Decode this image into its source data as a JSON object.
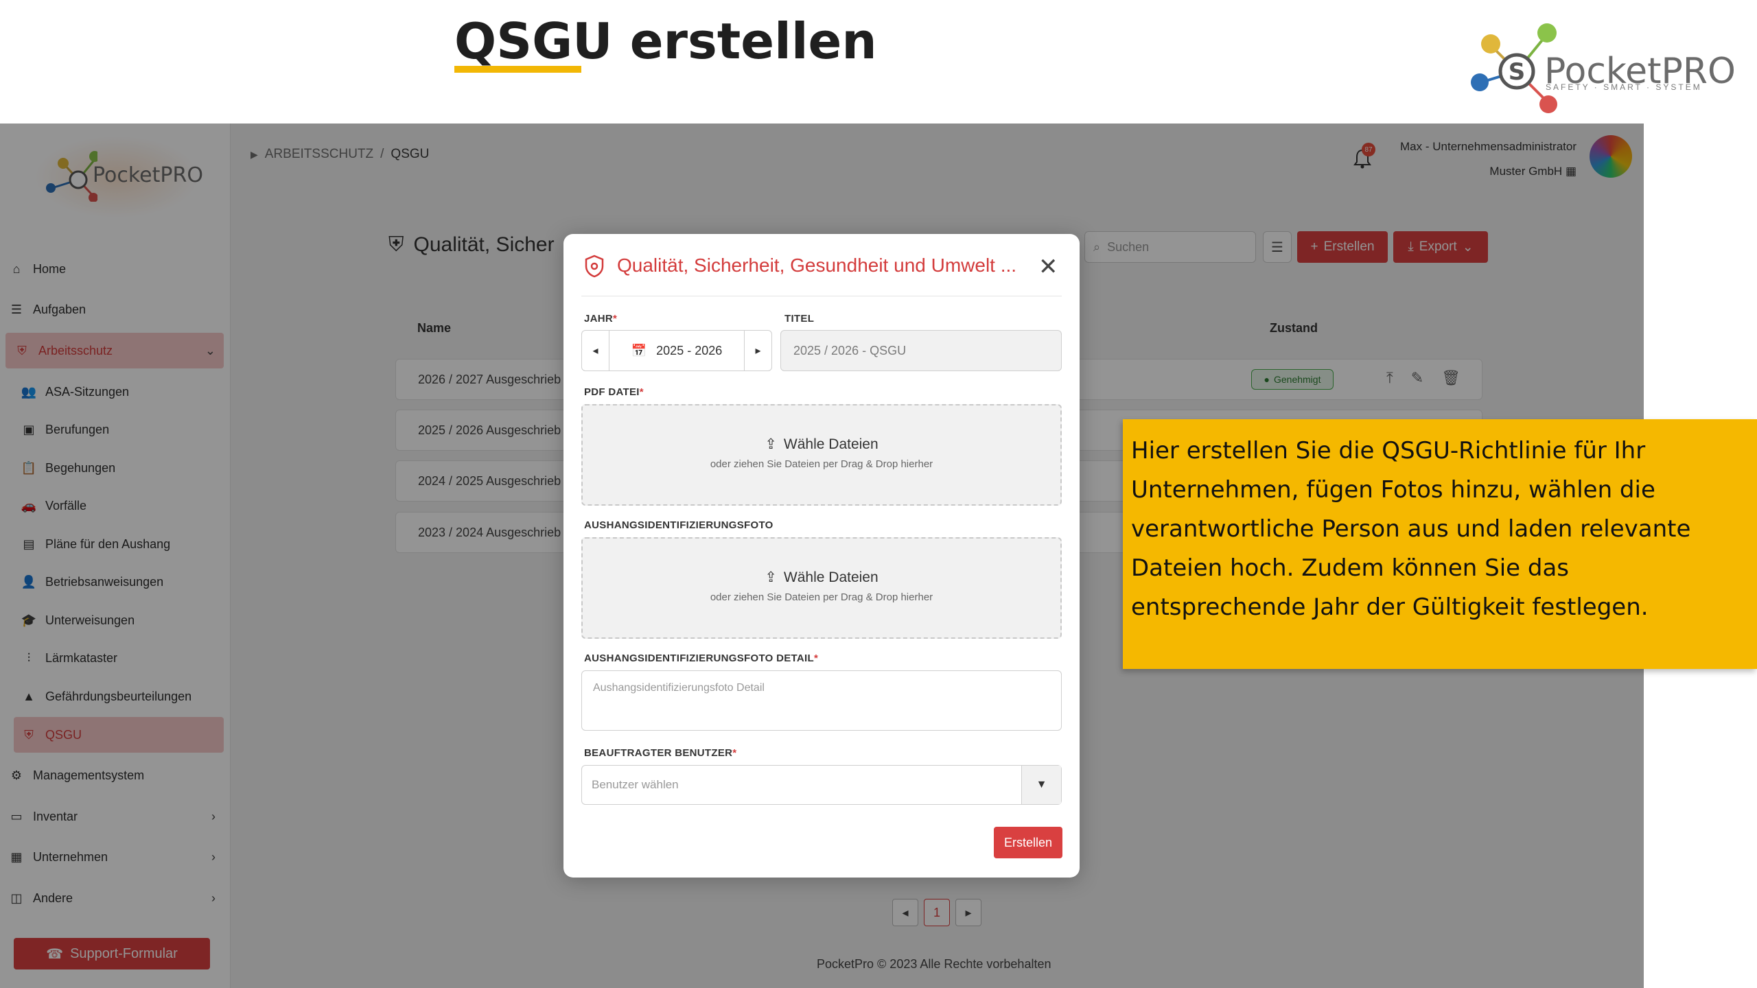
{
  "slide": {
    "title_bold": "QSGU",
    "title_rest": " erstellen",
    "brand_name": "PocketPRO",
    "brand_tagline": "SAFETY · SMART · SYSTEM"
  },
  "breadcrumb": {
    "parent": "ARBEITSSCHUTZ",
    "separator": "/",
    "current": "QSGU"
  },
  "user": {
    "name": "Max - Unternehmensadministrator",
    "company": "Muster GmbH",
    "notification_count": "87"
  },
  "sidebar": {
    "logo_text": "PocketPRO",
    "items": [
      {
        "label": "Home",
        "icon": "home-icon"
      },
      {
        "label": "Aufgaben",
        "icon": "list-icon"
      },
      {
        "label": "Arbeitsschutz",
        "icon": "shield-icon",
        "active_group": true
      },
      {
        "label": "ASA-Sitzungen",
        "icon": "people-icon"
      },
      {
        "label": "Berufungen",
        "icon": "badge-icon"
      },
      {
        "label": "Begehungen",
        "icon": "clipboard-icon"
      },
      {
        "label": "Vorfälle",
        "icon": "car-icon"
      },
      {
        "label": "Pläne für den Aushang",
        "icon": "document-icon"
      },
      {
        "label": "Betriebsanweisungen",
        "icon": "user-instruction-icon"
      },
      {
        "label": "Unterweisungen",
        "icon": "graduation-icon"
      },
      {
        "label": "Lärmkataster",
        "icon": "sound-icon"
      },
      {
        "label": "Gefährdungsbeurteilungen",
        "icon": "warning-icon"
      },
      {
        "label": "QSGU",
        "icon": "shield-icon",
        "active": true
      },
      {
        "label": "Managementsystem",
        "icon": "settings-box-icon"
      },
      {
        "label": "Inventar",
        "icon": "inventory-icon"
      },
      {
        "label": "Unternehmen",
        "icon": "building-icon"
      },
      {
        "label": "Andere",
        "icon": "other-icon"
      }
    ],
    "support_label": "Support-Formular"
  },
  "page": {
    "heading": "Qualität, Sicher",
    "search_placeholder": "Suchen",
    "create_label": "Erstellen",
    "export_label": "Export",
    "col_name": "Name",
    "col_status": "Zustand",
    "rows": [
      {
        "name": "2026 / 2027 Ausgeschrieb",
        "status": "Genehmigt"
      },
      {
        "name": "2025 / 2026 Ausgeschrieb"
      },
      {
        "name": "2024 / 2025 Ausgeschrieb"
      },
      {
        "name": "2023 / 2024 Ausgeschrieb"
      }
    ],
    "pager_current": "1",
    "footer": "PocketPro © 2023 Alle Rechte vorbehalten"
  },
  "modal": {
    "title": "Qualität, Sicherheit, Gesundheit und Umwelt ...",
    "year_label": "JAHR",
    "year_value": "2025 - 2026",
    "title_label": "TITEL",
    "title_value": "2025 / 2026 - QSGU",
    "pdf_label": "PDF DATEI",
    "choose_files": "Wähle Dateien",
    "drop_hint": "oder ziehen Sie Dateien per Drag & Drop hierher",
    "photo_label": "AUSHANGSIDENTIFIZIERUNGSFOTO",
    "photo_detail_label": "AUSHANGSIDENTIFIZIERUNGSFOTO DETAIL",
    "photo_detail_placeholder": "Aushangsidentifizierungsfoto Detail",
    "user_label": "BEAUFTRAGTER BENUTZER",
    "user_placeholder": "Benutzer wählen",
    "submit_label": "Erstellen",
    "required_mark": "*"
  },
  "callout": {
    "text": "Hier erstellen Sie die QSGU-Richtlinie für Ihr Unternehmen, fügen Fotos hinzu, wählen die verantwortliche Person aus und laden relevante Dateien hoch. Zudem können Sie das entsprechende Jahr der Gültigkeit festlegen."
  },
  "colors": {
    "accent": "#d94040",
    "highlight": "#f5b800",
    "success": "#4caf50"
  }
}
